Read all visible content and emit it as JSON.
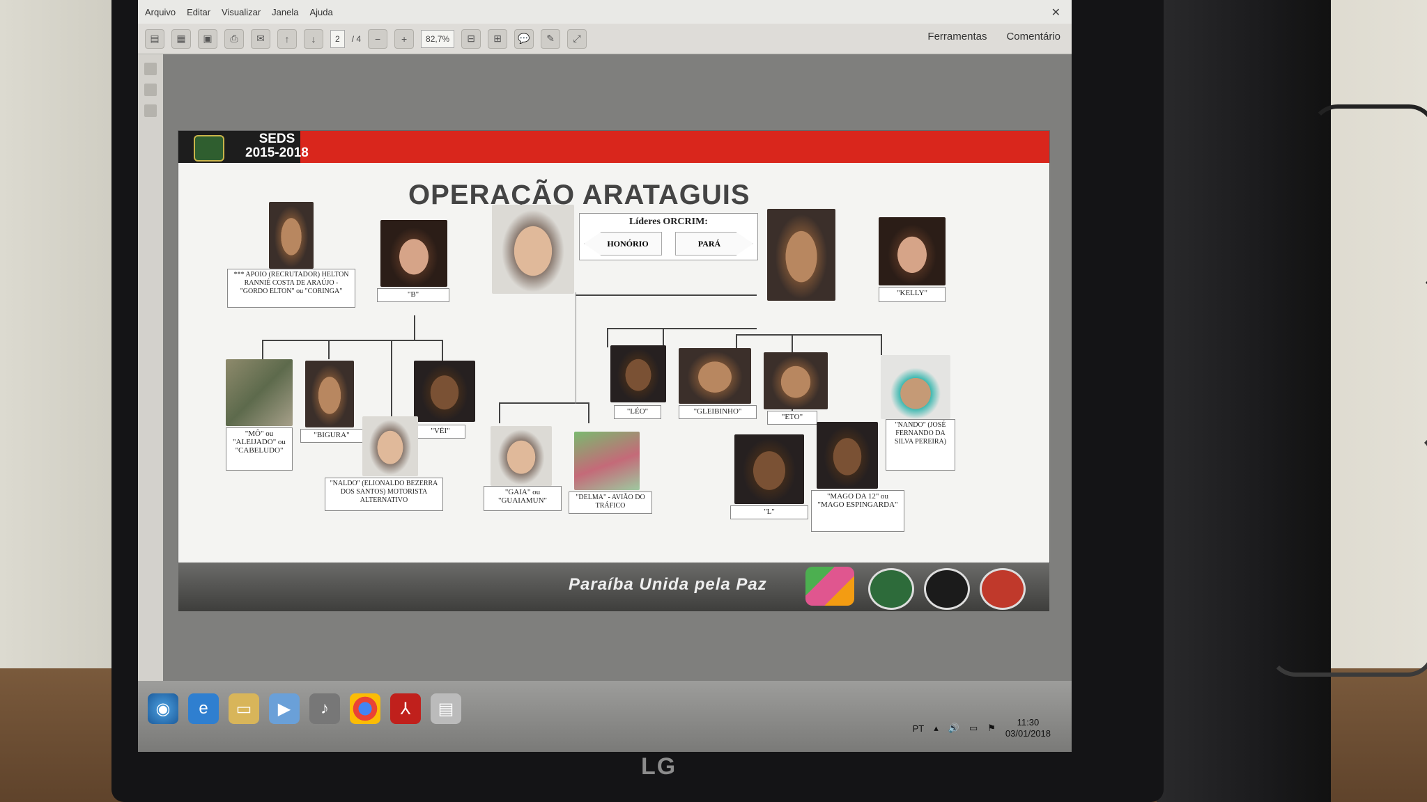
{
  "app": {
    "menu": [
      "Arquivo",
      "Editar",
      "Visualizar",
      "Janela",
      "Ajuda"
    ],
    "page_current": "2",
    "page_total": "/ 4",
    "zoom": "82,7%",
    "tools_label": "Ferramentas",
    "comment_label": "Comentário"
  },
  "slide": {
    "header_org": "SEDS",
    "header_years": "2015-2018",
    "title": "OPERAÇÃO ARATAGUIS",
    "leaders_title": "Líderes ORCRIM:",
    "leader_left": "HONÓRIO",
    "leader_right": "PARÁ",
    "footer": "Paraíba Unida pela Paz"
  },
  "people": {
    "apoio": "*** APOIO (RECRUTADOR) HELTON RANNIÉ COSTA DE ARAÚJO - \"GORDO ELTON\" ou \"CORINGA\"",
    "b": "\"B\"",
    "kelly": "\"KELLY\"",
    "mo": "\"MÔ\" ou \"ALEIJADO\" ou \"CABELUDO\"",
    "bigura": "\"BIGURA\"",
    "vei": "\"VÉI\"",
    "naldo": "\"NALDO\" (ELIONALDO BEZERRA DOS SANTOS) MOTORISTA ALTERNATIVO",
    "gaia": "\"GAIA\" ou \"GUAIAMUN\"",
    "delma": "\"DELMA\" - AVIÃO DO TRÁFICO",
    "leo": "\"LÉO\"",
    "gleibinho": "\"GLEIBINHO\"",
    "eto": "\"ETO\"",
    "nando": "\"NANDO\" (JOSÉ FERNANDO DA SILVA PEREIRA)",
    "l": "\"L\"",
    "mago": "\"MAGO DA 12\" ou \"MAGO ESPINGARDA\""
  },
  "taskbar": {
    "language": "PT",
    "time": "11:30",
    "date": "03/01/2018"
  },
  "monitor_brand": "LG"
}
